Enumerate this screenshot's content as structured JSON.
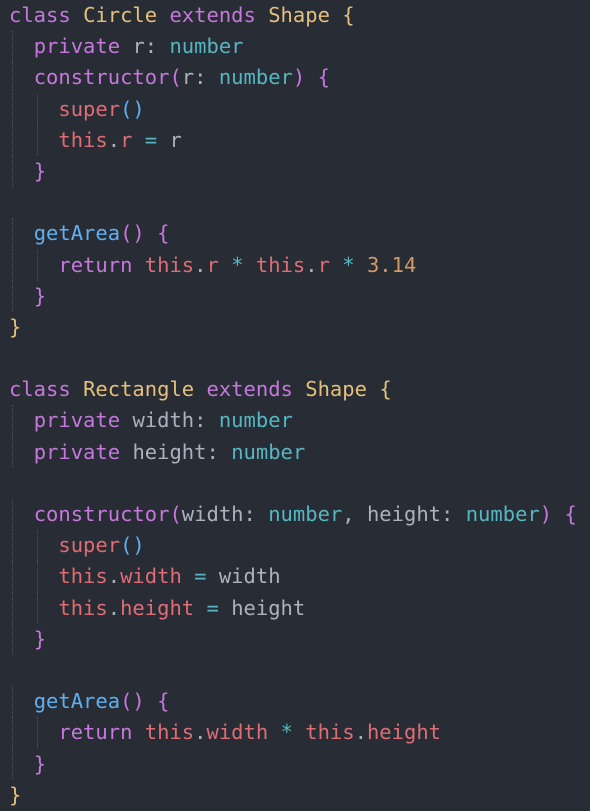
{
  "theme": {
    "background": "#282c34",
    "keyword": "#c678dd",
    "class_name": "#e5c07b",
    "type": "#56b6c2",
    "function": "#61afef",
    "this_var": "#e06c75",
    "property": "#e06c75",
    "operator": "#56b6c2",
    "number": "#d19a66",
    "default": "#abb2bf",
    "brace_outer": "#e5c07b",
    "brace_mid": "#c678dd",
    "paren": "#61afef"
  },
  "lines": [
    {
      "indent": 0,
      "tokens": [
        [
          "class",
          "keyword"
        ],
        [
          " ",
          "ws"
        ],
        [
          "Circle",
          "class_name"
        ],
        [
          " ",
          "ws"
        ],
        [
          "extends",
          "keyword"
        ],
        [
          " ",
          "ws"
        ],
        [
          "Shape",
          "class_name"
        ],
        [
          " ",
          "ws"
        ],
        [
          "{",
          "brace_outer"
        ]
      ]
    },
    {
      "indent": 1,
      "tokens": [
        [
          "private",
          "keyword"
        ],
        [
          " ",
          "ws"
        ],
        [
          "r",
          "default"
        ],
        [
          ":",
          "default"
        ],
        [
          " ",
          "ws"
        ],
        [
          "number",
          "type"
        ]
      ]
    },
    {
      "indent": 1,
      "tokens": [
        [
          "constructor",
          "keyword"
        ],
        [
          "(",
          "brace_mid"
        ],
        [
          "r",
          "default"
        ],
        [
          ":",
          "default"
        ],
        [
          " ",
          "ws"
        ],
        [
          "number",
          "type"
        ],
        [
          ")",
          "brace_mid"
        ],
        [
          " ",
          "ws"
        ],
        [
          "{",
          "brace_mid"
        ]
      ]
    },
    {
      "indent": 2,
      "tokens": [
        [
          "super",
          "this_var"
        ],
        [
          "()",
          "paren"
        ]
      ]
    },
    {
      "indent": 2,
      "tokens": [
        [
          "this",
          "this_var"
        ],
        [
          ".",
          "default"
        ],
        [
          "r",
          "property"
        ],
        [
          " ",
          "ws"
        ],
        [
          "=",
          "operator"
        ],
        [
          " ",
          "ws"
        ],
        [
          "r",
          "default"
        ]
      ]
    },
    {
      "indent": 1,
      "tokens": [
        [
          "}",
          "brace_mid"
        ]
      ]
    },
    {
      "indent": 0,
      "tokens": []
    },
    {
      "indent": 1,
      "tokens": [
        [
          "getArea",
          "function"
        ],
        [
          "()",
          "brace_mid"
        ],
        [
          " ",
          "ws"
        ],
        [
          "{",
          "brace_mid"
        ]
      ]
    },
    {
      "indent": 2,
      "tokens": [
        [
          "return",
          "keyword"
        ],
        [
          " ",
          "ws"
        ],
        [
          "this",
          "this_var"
        ],
        [
          ".",
          "default"
        ],
        [
          "r",
          "property"
        ],
        [
          " ",
          "ws"
        ],
        [
          "*",
          "operator"
        ],
        [
          " ",
          "ws"
        ],
        [
          "this",
          "this_var"
        ],
        [
          ".",
          "default"
        ],
        [
          "r",
          "property"
        ],
        [
          " ",
          "ws"
        ],
        [
          "*",
          "operator"
        ],
        [
          " ",
          "ws"
        ],
        [
          "3.14",
          "number"
        ]
      ]
    },
    {
      "indent": 1,
      "tokens": [
        [
          "}",
          "brace_mid"
        ]
      ]
    },
    {
      "indent": 0,
      "tokens": [
        [
          "}",
          "brace_outer"
        ]
      ]
    },
    {
      "indent": 0,
      "tokens": []
    },
    {
      "indent": 0,
      "tokens": [
        [
          "class",
          "keyword"
        ],
        [
          " ",
          "ws"
        ],
        [
          "Rectangle",
          "class_name"
        ],
        [
          " ",
          "ws"
        ],
        [
          "extends",
          "keyword"
        ],
        [
          " ",
          "ws"
        ],
        [
          "Shape",
          "class_name"
        ],
        [
          " ",
          "ws"
        ],
        [
          "{",
          "brace_outer"
        ]
      ]
    },
    {
      "indent": 1,
      "tokens": [
        [
          "private",
          "keyword"
        ],
        [
          " ",
          "ws"
        ],
        [
          "width",
          "default"
        ],
        [
          ":",
          "default"
        ],
        [
          " ",
          "ws"
        ],
        [
          "number",
          "type"
        ]
      ]
    },
    {
      "indent": 1,
      "tokens": [
        [
          "private",
          "keyword"
        ],
        [
          " ",
          "ws"
        ],
        [
          "height",
          "default"
        ],
        [
          ":",
          "default"
        ],
        [
          " ",
          "ws"
        ],
        [
          "number",
          "type"
        ]
      ]
    },
    {
      "indent": 0,
      "tokens": []
    },
    {
      "indent": 1,
      "tokens": [
        [
          "constructor",
          "keyword"
        ],
        [
          "(",
          "brace_mid"
        ],
        [
          "width",
          "default"
        ],
        [
          ":",
          "default"
        ],
        [
          " ",
          "ws"
        ],
        [
          "number",
          "type"
        ],
        [
          ",",
          "default"
        ],
        [
          " ",
          "ws"
        ],
        [
          "height",
          "default"
        ],
        [
          ":",
          "default"
        ],
        [
          " ",
          "ws"
        ],
        [
          "number",
          "type"
        ],
        [
          ")",
          "brace_mid"
        ],
        [
          " ",
          "ws"
        ],
        [
          "{",
          "brace_mid"
        ]
      ]
    },
    {
      "indent": 2,
      "tokens": [
        [
          "super",
          "this_var"
        ],
        [
          "()",
          "paren"
        ]
      ]
    },
    {
      "indent": 2,
      "tokens": [
        [
          "this",
          "this_var"
        ],
        [
          ".",
          "default"
        ],
        [
          "width",
          "property"
        ],
        [
          " ",
          "ws"
        ],
        [
          "=",
          "operator"
        ],
        [
          " ",
          "ws"
        ],
        [
          "width",
          "default"
        ]
      ]
    },
    {
      "indent": 2,
      "tokens": [
        [
          "this",
          "this_var"
        ],
        [
          ".",
          "default"
        ],
        [
          "height",
          "property"
        ],
        [
          " ",
          "ws"
        ],
        [
          "=",
          "operator"
        ],
        [
          " ",
          "ws"
        ],
        [
          "height",
          "default"
        ]
      ]
    },
    {
      "indent": 1,
      "tokens": [
        [
          "}",
          "brace_mid"
        ]
      ]
    },
    {
      "indent": 0,
      "tokens": []
    },
    {
      "indent": 1,
      "tokens": [
        [
          "getArea",
          "function"
        ],
        [
          "()",
          "brace_mid"
        ],
        [
          " ",
          "ws"
        ],
        [
          "{",
          "brace_mid"
        ]
      ]
    },
    {
      "indent": 2,
      "tokens": [
        [
          "return",
          "keyword"
        ],
        [
          " ",
          "ws"
        ],
        [
          "this",
          "this_var"
        ],
        [
          ".",
          "default"
        ],
        [
          "width",
          "property"
        ],
        [
          " ",
          "ws"
        ],
        [
          "*",
          "operator"
        ],
        [
          " ",
          "ws"
        ],
        [
          "this",
          "this_var"
        ],
        [
          ".",
          "default"
        ],
        [
          "height",
          "property"
        ]
      ]
    },
    {
      "indent": 1,
      "tokens": [
        [
          "}",
          "brace_mid"
        ]
      ]
    },
    {
      "indent": 0,
      "tokens": [
        [
          "}",
          "brace_outer"
        ]
      ]
    }
  ]
}
